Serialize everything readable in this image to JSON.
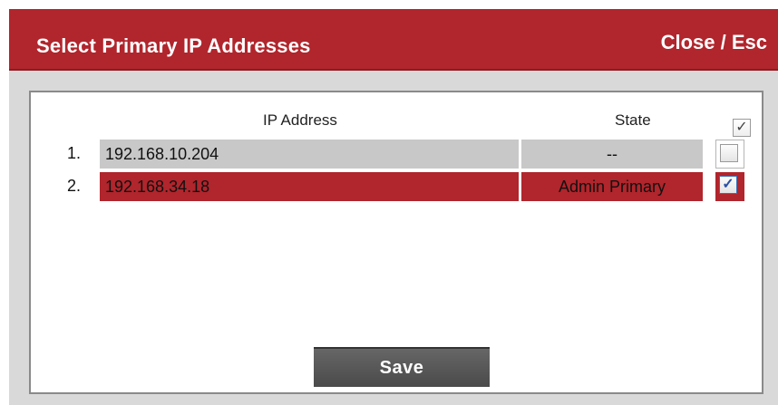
{
  "dialog": {
    "title": "Select Primary IP Addresses",
    "close_label": "Close / Esc"
  },
  "table": {
    "headers": {
      "ip": "IP Address",
      "state": "State"
    },
    "select_all_checked": true,
    "rows": [
      {
        "index": "1.",
        "ip": "192.168.10.204",
        "state": "--",
        "checked": false
      },
      {
        "index": "2.",
        "ip": "192.168.34.18",
        "state": "Admin Primary",
        "checked": true
      }
    ]
  },
  "actions": {
    "save_label": "Save"
  },
  "colors": {
    "accent_red": "#b1252c",
    "row_gray": "#c8c8c8",
    "button_dark": "#555555"
  }
}
